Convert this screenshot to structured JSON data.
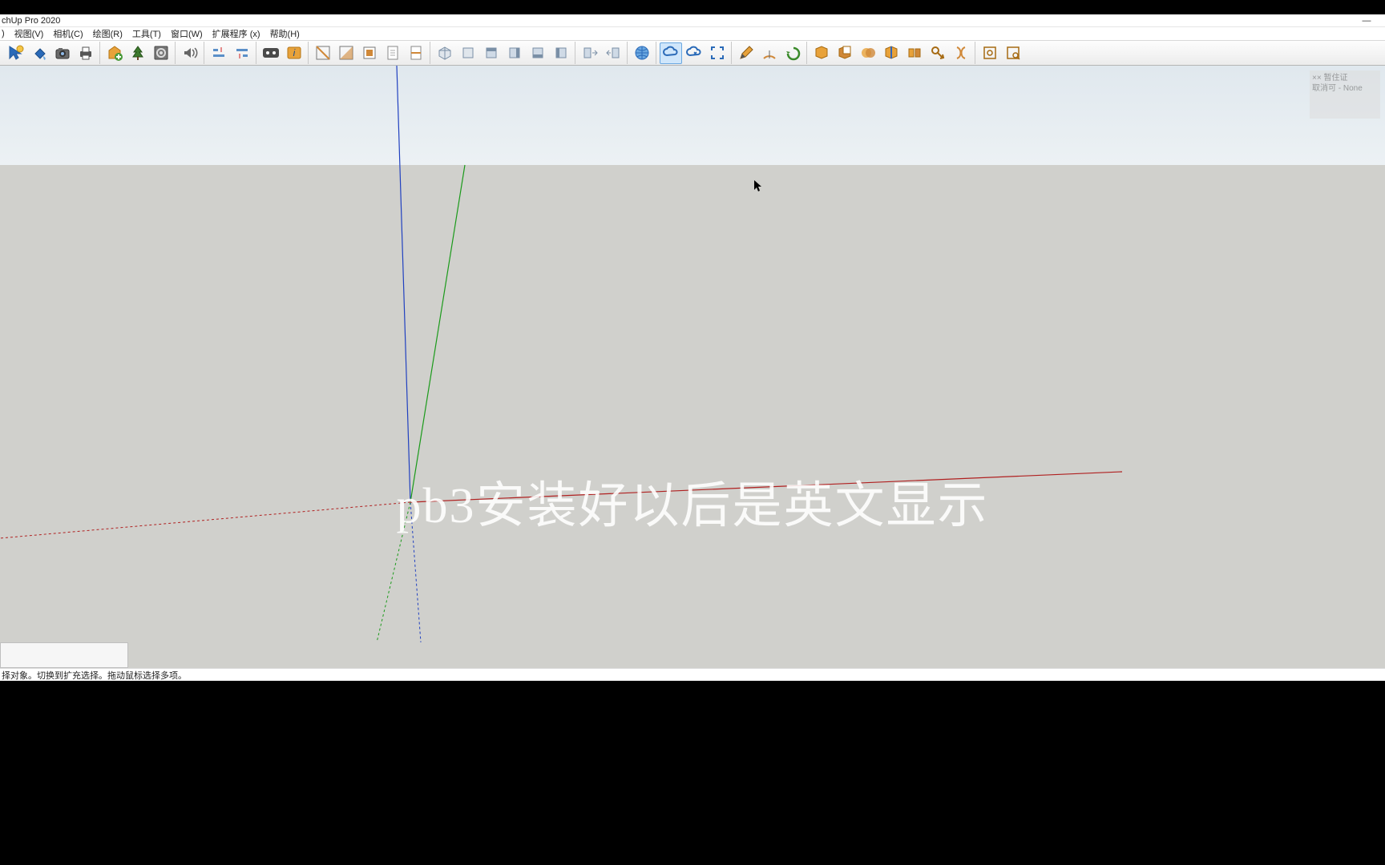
{
  "title": "chUp Pro 2020",
  "window_controls": {
    "min": "—"
  },
  "menu": {
    "items": [
      ")",
      "视图(V)",
      "相机(C)",
      "绘图(R)",
      "工具(T)",
      "窗口(W)",
      "扩展程序 (x)",
      "帮助(H)"
    ]
  },
  "toolbar": {
    "groups": [
      {
        "name": "style",
        "icons": [
          "sel-arrow",
          "paint-bucket",
          "camera",
          "printer"
        ]
      },
      {
        "name": "warehouse",
        "icons": [
          "warehouse-add",
          "tree",
          "gear-dialog"
        ]
      },
      {
        "name": "sound",
        "icons": [
          "speaker"
        ]
      },
      {
        "name": "align",
        "icons": [
          "align-h",
          "align-v"
        ]
      },
      {
        "name": "info",
        "icons": [
          "dims-badge",
          "info-badge"
        ]
      },
      {
        "name": "section",
        "icons": [
          "section-plane",
          "section-fill",
          "section-cut",
          "section-page",
          "section-page2"
        ]
      },
      {
        "name": "views",
        "icons": [
          "view-iso",
          "view-top",
          "view-front",
          "view-right",
          "view-back",
          "view-left"
        ]
      },
      {
        "name": "view2",
        "icons": [
          "look-around",
          "position-cam"
        ]
      },
      {
        "name": "geo",
        "icons": [
          "globe"
        ]
      },
      {
        "name": "cloud",
        "icons": [
          "cloud-link",
          "cloud-open",
          "fullscreen"
        ]
      },
      {
        "name": "draw",
        "icons": [
          "pencil",
          "protractor",
          "rewind"
        ]
      },
      {
        "name": "solid",
        "icons": [
          "solid-union",
          "solid-subtract",
          "solid-intersect",
          "solid-trim",
          "solid-split",
          "solid-shell",
          "solid-outer"
        ]
      },
      {
        "name": "zoom",
        "icons": [
          "zoom-window",
          "zoom-extents"
        ]
      }
    ],
    "active_icon": "cloud-link"
  },
  "instructor_panel": {
    "line1": "××  暂住证",
    "line2": "取消可 - None"
  },
  "overlay_caption": "pb3安装好以后是英文显示",
  "status_text": "择对象。切换到扩充选择。拖动鼠标选择多项。"
}
